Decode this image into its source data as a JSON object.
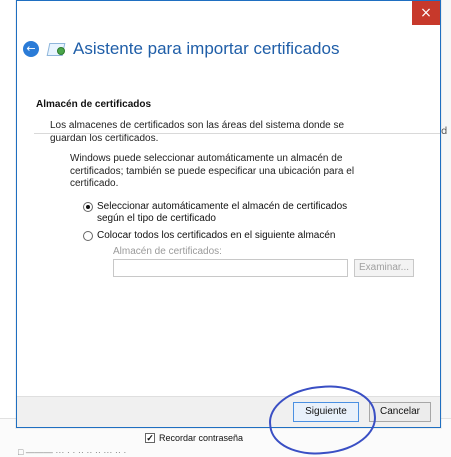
{
  "dialog": {
    "title": "Asistente para importar certificados",
    "close_label": "×",
    "back_label": "←",
    "section_title": "Almacén de certificados",
    "section_description": "Los almacenes de certificados son las áreas del sistema donde se guardan los certificados.",
    "intro_text": "Windows puede seleccionar automáticamente un almacén de certificados; también se puede especificar una ubicación para el certificado.",
    "options": [
      {
        "label": "Seleccionar automáticamente el almacén de certificados según el tipo de certificado",
        "selected": true
      },
      {
        "label": "Colocar todos los certificados en el siguiente almacén",
        "selected": false
      }
    ],
    "store_field": {
      "label": "Almacén de certificados:",
      "value": "",
      "browse_button": "Examinar..."
    },
    "buttons": {
      "next": "Siguiente",
      "cancel": "Cancelar"
    }
  },
  "background": {
    "remember_password": "Recordar contraseña",
    "remember_checked": true,
    "edge_hint": "d",
    "bottom_text": "□   ——— ··· · · ·· ·· ·· ··· ·· ·"
  },
  "annotation": {
    "color": "#3a4fc4"
  }
}
